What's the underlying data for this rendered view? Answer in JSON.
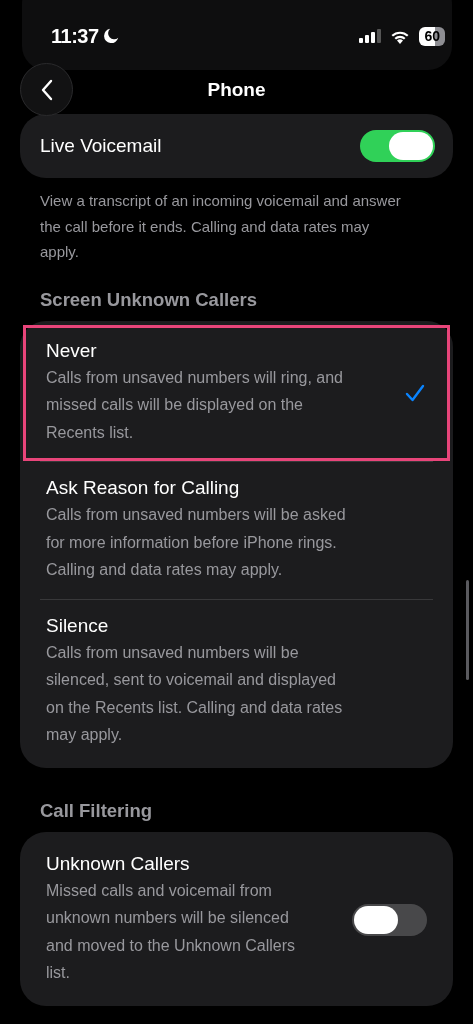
{
  "status_bar": {
    "time": "11:37",
    "focus_moon": true,
    "battery": "60"
  },
  "nav": {
    "title": "Phone"
  },
  "live_voicemail": {
    "label": "Live Voicemail",
    "on": true,
    "footer": "View a transcript of an incoming voicemail and answer\nthe call before it ends. Calling and data rates may\napply."
  },
  "screen_unknown_callers": {
    "header": "Screen Unknown Callers",
    "options": [
      {
        "title": "Never",
        "description": "Calls from unsaved numbers will ring, and\nmissed calls will be displayed on the\nRecents list.",
        "selected": true,
        "highlighted": true
      },
      {
        "title": "Ask Reason for Calling",
        "description": "Calls from unsaved numbers will be asked\nfor more information before iPhone rings.\nCalling and data rates may apply.",
        "selected": false,
        "highlighted": false
      },
      {
        "title": "Silence",
        "description": "Calls from unsaved numbers will be\nsilenced, sent to voicemail and displayed\non the Recents list. Calling and data rates\nmay apply.",
        "selected": false,
        "highlighted": false
      }
    ]
  },
  "call_filtering": {
    "header": "Call Filtering",
    "items": [
      {
        "title": "Unknown Callers",
        "description": "Missed calls and voicemail from\nunknown numbers will be silenced\nand moved to the Unknown Callers\nlist.",
        "on": false
      }
    ]
  }
}
